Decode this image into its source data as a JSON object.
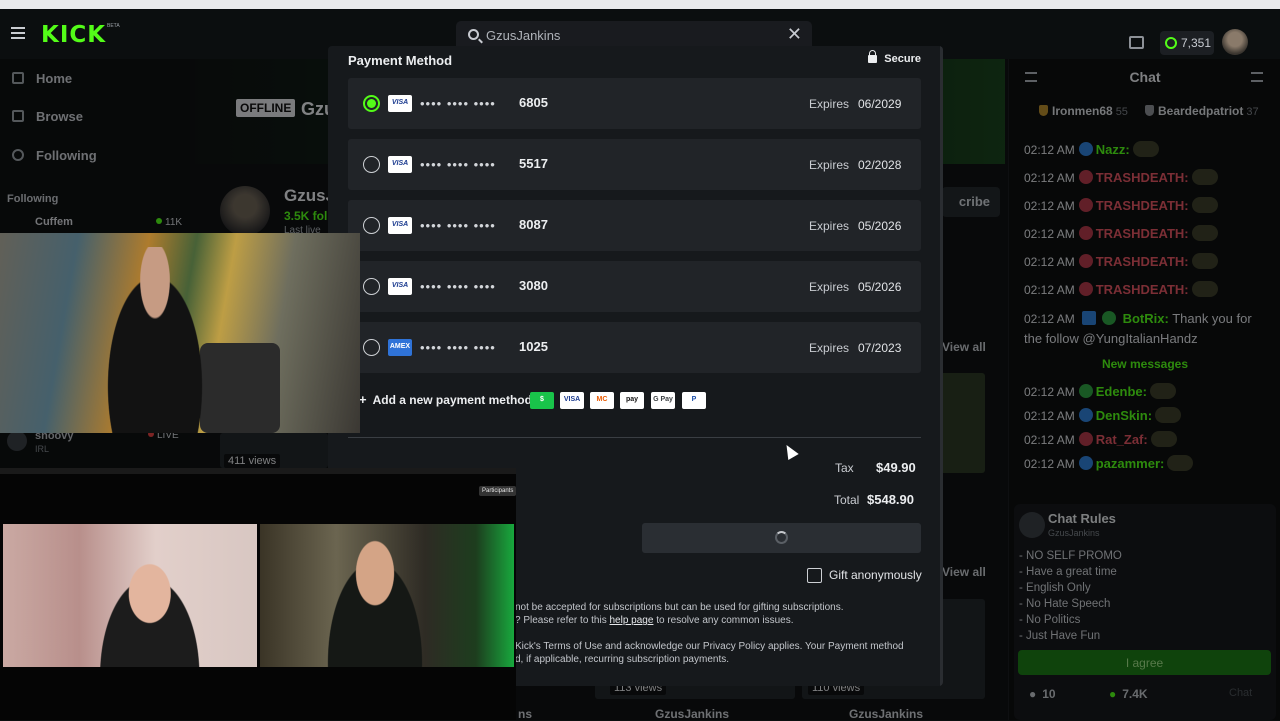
{
  "topbar": {
    "logo": "KICK",
    "logo_beta": "BETA",
    "search_value": "GzusJankins",
    "coins": "7,351",
    "icons": [
      "hamburger-icon",
      "search-icon",
      "close-icon",
      "dashboard-icon",
      "coin-icon"
    ]
  },
  "sidebar": {
    "nav": [
      {
        "label": "Home",
        "icon": "home-icon"
      },
      {
        "label": "Browse",
        "icon": "browse-icon"
      },
      {
        "label": "Following",
        "icon": "heart-icon"
      }
    ],
    "following_heading": "Following",
    "followed": [
      {
        "name": "Cuffem",
        "viewers": "11K"
      },
      {
        "name": "shoovy",
        "game": "IRL",
        "status": "LIVE"
      }
    ]
  },
  "channel": {
    "offline_badge": "OFFLINE",
    "name_fragment": "Gzu",
    "name": "GzusJ",
    "followers": "3.5K foll",
    "last_live": "Last live",
    "subscribe_fragment": "cribe",
    "view_all": "View all",
    "thumb_views": [
      "411 views",
      "113 views",
      "110 views"
    ],
    "bottom_channels": [
      "GzusJankins",
      "GzusJankins"
    ],
    "bottom_fragment": "ns"
  },
  "chat": {
    "title": "Chat",
    "top_gifters": [
      {
        "name": "Ironmen68",
        "count": "55"
      },
      {
        "name": "Beardedpatriot",
        "count": "37"
      }
    ],
    "messages": [
      {
        "time": "02:12 AM",
        "user": "Nazz:",
        "color": "#53fc18",
        "badge_color": "#2f7fd6"
      },
      {
        "time": "02:12 AM",
        "user": "TRASHDEATH:",
        "color": "#e05561",
        "badge_color": "#b13a4a"
      },
      {
        "time": "02:12 AM",
        "user": "TRASHDEATH:",
        "color": "#e05561",
        "badge_color": "#b13a4a"
      },
      {
        "time": "02:12 AM",
        "user": "TRASHDEATH:",
        "color": "#e05561",
        "badge_color": "#b13a4a"
      },
      {
        "time": "02:12 AM",
        "user": "TRASHDEATH:",
        "color": "#e05561",
        "badge_color": "#b13a4a"
      },
      {
        "time": "02:12 AM",
        "user": "TRASHDEATH:",
        "color": "#e05561",
        "badge_color": "#b13a4a"
      }
    ],
    "bot_time": "02:12 AM",
    "bot_user": "BotRix:",
    "bot_text": "Thank you for the follow @YungItalianHandz",
    "new_messages": "New messages",
    "after_messages": [
      {
        "time": "02:12 AM",
        "user": "Edenbe:",
        "color": "#53fc18",
        "badge_color": "#2ea043"
      },
      {
        "time": "02:12 AM",
        "user": "DenSkin:",
        "color": "#53fc18",
        "badge_color": "#2f7fd6"
      },
      {
        "time": "02:12 AM",
        "user": "Rat_Zaf:",
        "color": "#e05561",
        "badge_color": "#b13a4a"
      },
      {
        "time": "02:12 AM",
        "user": "pazammer:",
        "color": "#53fc18",
        "badge_color": "#2f7fd6"
      }
    ],
    "rules": {
      "title": "Chat Rules",
      "subtitle": "GzusJankins",
      "items": [
        "- NO SELF PROMO",
        "- Have a great time",
        "- English Only",
        "- No Hate Speech",
        "- No Politics",
        "- Just Have Fun"
      ],
      "agree": "I agree"
    },
    "footer": {
      "count1": "10",
      "count2": "7.4K",
      "send": "Chat"
    }
  },
  "modal": {
    "title": "Payment Method",
    "secure": "Secure",
    "expires_label": "Expires",
    "cards": [
      {
        "brand": "VISA",
        "dots": "•••• •••• ••••",
        "last4": "6805",
        "expires": "06/2029",
        "selected": true
      },
      {
        "brand": "VISA",
        "dots": "•••• •••• ••••",
        "last4": "5517",
        "expires": "02/2028",
        "selected": false
      },
      {
        "brand": "VISA",
        "dots": "•••• •••• ••••",
        "last4": "8087",
        "expires": "05/2026",
        "selected": false
      },
      {
        "brand": "VISA",
        "dots": "•••• •••• ••••",
        "last4": "3080",
        "expires": "05/2026",
        "selected": false
      },
      {
        "brand": "AMEX",
        "dots": "•••• •••• ••••",
        "last4": "1025",
        "expires": "07/2023",
        "selected": false
      }
    ],
    "add_method": "Add a new payment method",
    "pay_logos": [
      {
        "label": "$",
        "bg": "#19c44a",
        "fg": "#ffffff"
      },
      {
        "label": "VISA",
        "bg": "#ffffff",
        "fg": "#1a3a8f"
      },
      {
        "label": "MC",
        "bg": "#ffffff",
        "fg": "#eb5a00"
      },
      {
        "label": "pay",
        "bg": "#ffffff",
        "fg": "#111111"
      },
      {
        "label": "G Pay",
        "bg": "#ffffff",
        "fg": "#3c4043"
      },
      {
        "label": "P",
        "bg": "#ffffff",
        "fg": "#1b4ea8"
      }
    ],
    "tax_label": "Tax",
    "tax": "$49.90",
    "total_label": "Total",
    "total": "$548.90",
    "gift_label": "Gift anonymously",
    "fine_1": "not be accepted for subscriptions but can be used for gifting subscriptions.",
    "fine_2a": "? Please refer to this ",
    "fine_2_link": "help page",
    "fine_2b": " to resolve any common issues.",
    "fine_3": "Kick's Terms of Use and acknowledge our Privacy Policy applies. Your Payment method",
    "fine_4": "d, if applicable, recurring subscription payments."
  },
  "call": {
    "participants": "Participants"
  }
}
